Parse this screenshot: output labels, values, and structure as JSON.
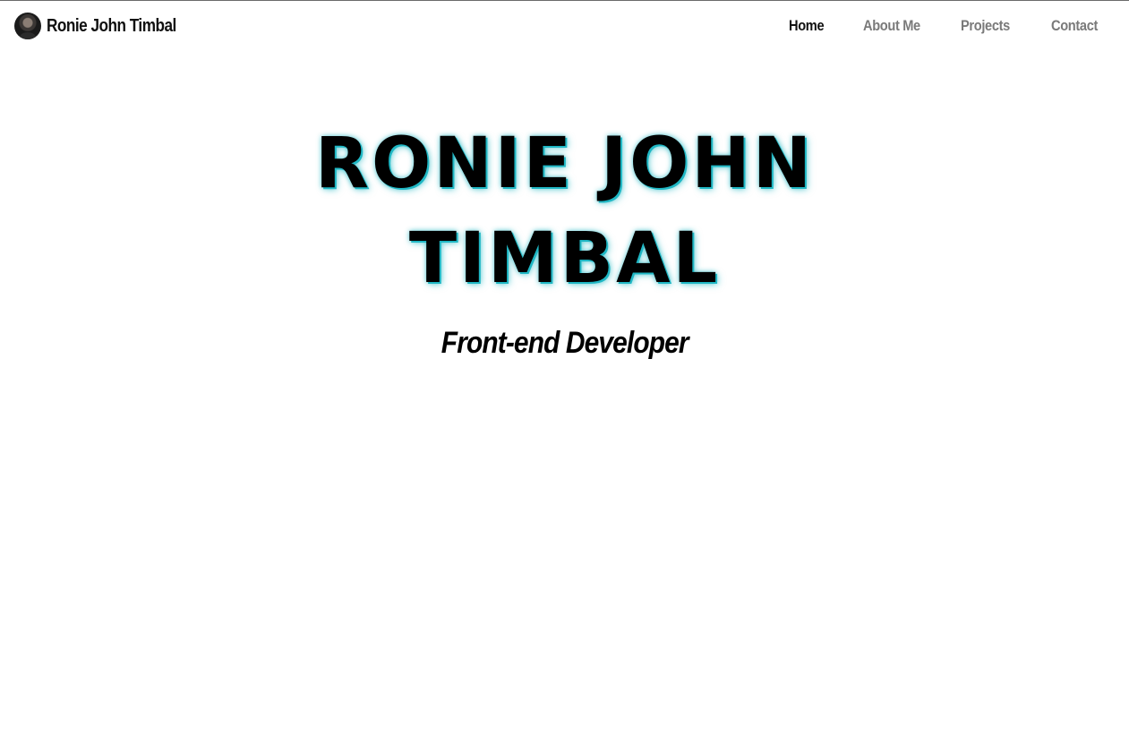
{
  "navbar": {
    "brand": {
      "name": "Ronie John Timbal",
      "avatar_icon": "profile-photo"
    },
    "links": [
      {
        "label": "Home",
        "active": true
      },
      {
        "label": "About Me",
        "active": false
      },
      {
        "label": "Projects",
        "active": false
      },
      {
        "label": "Contact",
        "active": false
      }
    ]
  },
  "hero": {
    "title": "RONIE JOHN TIMBAL",
    "subtitle": "Front-end Developer"
  },
  "colors": {
    "background": "#ffffff",
    "text": "#000000",
    "nav_inactive": "#7a7a7a",
    "title_glow": "#1fb7c4"
  }
}
